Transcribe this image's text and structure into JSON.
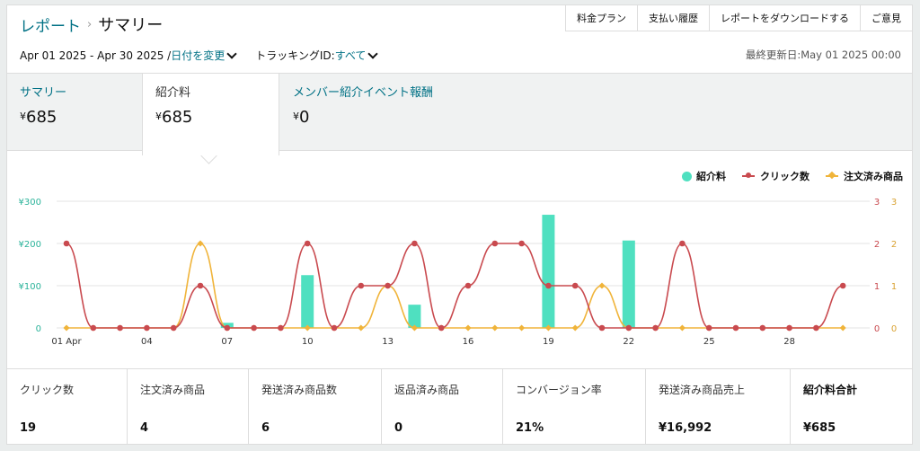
{
  "breadcrumb": {
    "parent": "レポート",
    "separator": "›",
    "current": "サマリー"
  },
  "top_buttons": [
    "料金プラン",
    "支払い履歴",
    "レポートをダウンロードする",
    "ご意見"
  ],
  "filters": {
    "date_range": "Apr 01 2025 - Apr 30 2025 /",
    "change_date": "日付を変更",
    "tracking_prefix": "トラッキングID:",
    "tracking_value": "すべて"
  },
  "last_updated": "最終更新日:May 01 2025 00:00",
  "tabs": [
    {
      "label": "サマリー",
      "value": "685",
      "currency": "¥"
    },
    {
      "label": "紹介料",
      "value": "685",
      "currency": "¥"
    },
    {
      "label": "メンバー紹介イベント報酬",
      "value": "0",
      "currency": "¥"
    }
  ],
  "colors": {
    "link": "#007185",
    "fee": "#4fe0c0",
    "clicks": "#c94a4f",
    "orders": "#f0b43a"
  },
  "chart_data": {
    "type": "bar+line",
    "legend": [
      "紹介料",
      "クリック数",
      "注文済み商品"
    ],
    "legend_position": "top-right",
    "x": [
      "01 Apr",
      "02",
      "03",
      "04",
      "05",
      "06",
      "07",
      "08",
      "09",
      "10",
      "11",
      "12",
      "13",
      "14",
      "15",
      "16",
      "17",
      "18",
      "19",
      "20",
      "21",
      "22",
      "23",
      "24",
      "25",
      "26",
      "27",
      "28",
      "29",
      "30"
    ],
    "x_ticks": [
      "01 Apr",
      "04",
      "07",
      "10",
      "13",
      "16",
      "19",
      "22",
      "25",
      "28"
    ],
    "left_axis": {
      "ticks": [
        "¥300",
        "¥200",
        "¥100",
        "0"
      ],
      "range": [
        0,
        300
      ]
    },
    "right_axis_clicks": {
      "ticks": [
        "3",
        "2",
        "1",
        "0"
      ],
      "range": [
        0,
        3
      ]
    },
    "right_axis_orders": {
      "ticks": [
        "3",
        "2",
        "1",
        "0"
      ],
      "range": [
        0,
        3
      ]
    },
    "series": [
      {
        "name": "紹介料",
        "type": "bar",
        "values": [
          0,
          0,
          0,
          0,
          0,
          0,
          12,
          0,
          0,
          125,
          0,
          0,
          0,
          55,
          0,
          0,
          0,
          0,
          268,
          0,
          0,
          207,
          0,
          0,
          0,
          0,
          0,
          0,
          0,
          0
        ]
      },
      {
        "name": "クリック数",
        "type": "line",
        "values": [
          2,
          0,
          0,
          0,
          0,
          1,
          0,
          0,
          0,
          2,
          0,
          1,
          1,
          2,
          0,
          1,
          2,
          2,
          1,
          1,
          0,
          0,
          0,
          2,
          0,
          0,
          0,
          0,
          0,
          1
        ]
      },
      {
        "name": "注文済み商品",
        "type": "line",
        "values": [
          0,
          0,
          0,
          0,
          0,
          2,
          0,
          0,
          0,
          0,
          0,
          0,
          1,
          0,
          0,
          0,
          0,
          0,
          0,
          0,
          1,
          0,
          0,
          0,
          0,
          0,
          0,
          0,
          0,
          0
        ]
      }
    ]
  },
  "stats": [
    {
      "label": "クリック数",
      "value": "19"
    },
    {
      "label": "注文済み商品",
      "value": "4"
    },
    {
      "label": "発送済み商品数",
      "value": "6"
    },
    {
      "label": "返品済み商品",
      "value": "0"
    },
    {
      "label": "コンバージョン率",
      "value": "21%"
    },
    {
      "label": "発送済み商品売上",
      "value": "¥16,992"
    },
    {
      "label": "紹介料合計",
      "value": "¥685"
    }
  ]
}
